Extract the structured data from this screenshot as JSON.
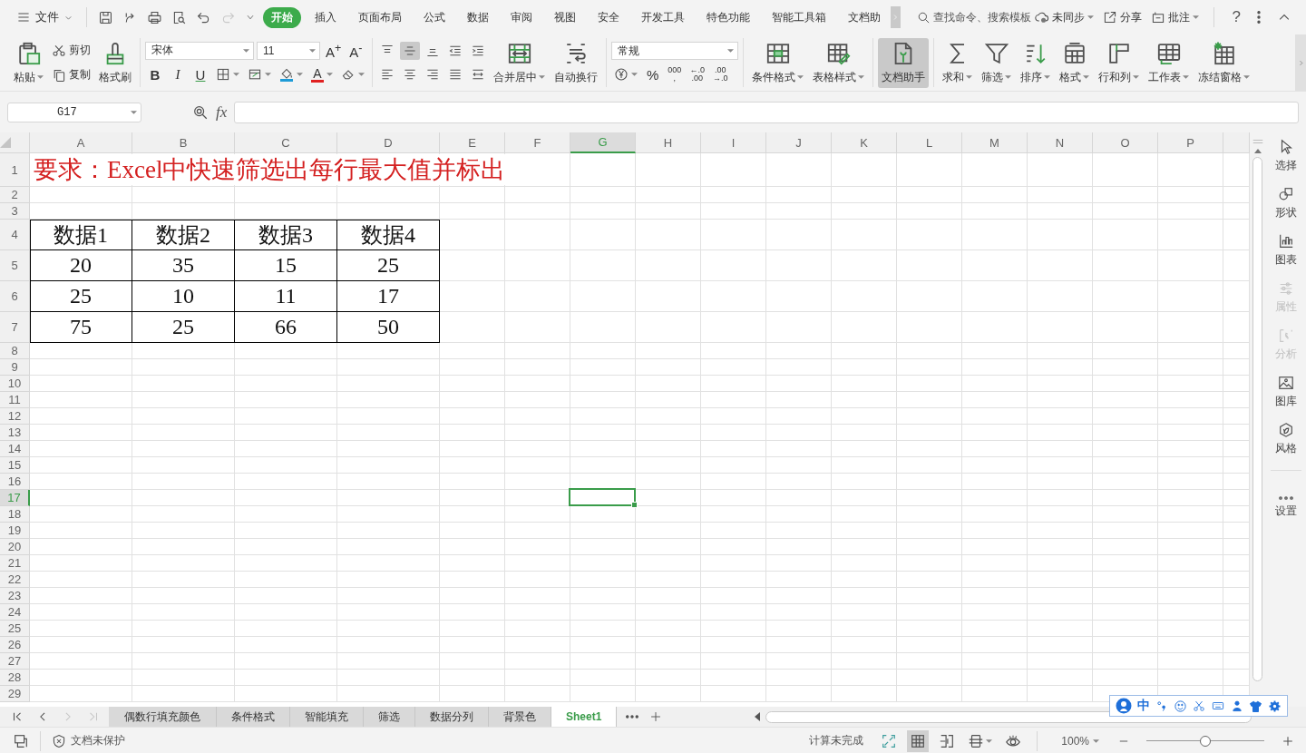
{
  "topbar": {
    "file_menu": "文件",
    "quick_access": [
      {
        "disabled": false
      },
      {
        "disabled": false
      },
      {
        "disabled": false
      },
      {
        "disabled": false
      },
      {
        "disabled": false
      },
      {
        "disabled": true
      }
    ],
    "tabs": [
      {
        "label": "开始",
        "selected": true
      },
      {
        "label": "插入",
        "selected": false
      },
      {
        "label": "页面布局",
        "selected": false
      },
      {
        "label": "公式",
        "selected": false
      },
      {
        "label": "数据",
        "selected": false
      },
      {
        "label": "审阅",
        "selected": false
      },
      {
        "label": "视图",
        "selected": false
      },
      {
        "label": "安全",
        "selected": false
      },
      {
        "label": "开发工具",
        "selected": false
      },
      {
        "label": "特色功能",
        "selected": false
      },
      {
        "label": "智能工具箱",
        "selected": false
      },
      {
        "label": "文档助",
        "selected": false
      }
    ],
    "search": {
      "placeholder": "查找命令、搜索模板"
    },
    "actions": [
      {
        "label": "未同步",
        "dropdown": true
      },
      {
        "label": "分享",
        "dropdown": false
      },
      {
        "label": "批注",
        "dropdown": true
      }
    ],
    "help": "?"
  },
  "ribbon": {
    "paste": "粘贴",
    "cut": "剪切",
    "copy": "复制",
    "format_painter": "格式刷",
    "font_name": "宋体",
    "font_size": "11",
    "font_size_buttons": [
      "A$^{+}$",
      "A$^{-}$"
    ],
    "font_style_buttons": [
      "B",
      "I",
      "U"
    ],
    "font_color": "A",
    "vertical_align": [
      {
        "selected": false
      },
      {
        "selected": true
      },
      {
        "selected": false
      }
    ],
    "horizontal_align": [
      {
        "selected": false
      },
      {
        "selected": false
      },
      {
        "selected": false
      },
      {
        "selected": false
      }
    ],
    "merge_center": "合并居中",
    "wrap_text": "自动换行",
    "number_format": "常规",
    "percent": "%",
    "thousands": [
      "000",
      ","
    ],
    "decimal_increase": [
      "←.0",
      ".00"
    ],
    "decimal_decrease": [
      ".00",
      "→.0"
    ],
    "tool_groups": [
      [
        {
          "label": "条件格式",
          "dropdown": true,
          "selected": false
        },
        {
          "label": "表格样式",
          "dropdown": true,
          "selected": false
        }
      ],
      [
        {
          "label": "文档助手",
          "dropdown": false,
          "selected": true
        }
      ],
      [
        {
          "label": "求和",
          "dropdown": true,
          "selected": false
        },
        {
          "label": "筛选",
          "dropdown": true,
          "selected": false
        },
        {
          "label": "排序",
          "dropdown": true,
          "selected": false
        },
        {
          "label": "格式",
          "dropdown": true,
          "selected": false
        },
        {
          "label": "行和列",
          "dropdown": true,
          "selected": false
        },
        {
          "label": "工作表",
          "dropdown": true,
          "selected": false
        },
        {
          "label": "冻结窗格",
          "dropdown": true,
          "selected": false
        }
      ]
    ]
  },
  "formula_bar": {
    "name_box": "G17",
    "fx": "fx"
  },
  "sheet": {
    "columns": [
      {
        "label": "A",
        "selected": false
      },
      {
        "label": "B",
        "selected": false
      },
      {
        "label": "C",
        "selected": false
      },
      {
        "label": "D",
        "selected": false
      },
      {
        "label": "E",
        "selected": false
      },
      {
        "label": "F",
        "selected": false
      },
      {
        "label": "G",
        "selected": true
      },
      {
        "label": "H",
        "selected": false
      },
      {
        "label": "I",
        "selected": false
      },
      {
        "label": "J",
        "selected": false
      },
      {
        "label": "K",
        "selected": false
      },
      {
        "label": "L",
        "selected": false
      },
      {
        "label": "M",
        "selected": false
      },
      {
        "label": "N",
        "selected": false
      },
      {
        "label": "O",
        "selected": false
      },
      {
        "label": "P",
        "selected": false
      }
    ],
    "rows": [
      {
        "label": "1",
        "selected": false,
        "kind": "title",
        "cells": [
          "要求：Excel中快速筛选出每行最大值并标出"
        ]
      },
      {
        "label": "2",
        "selected": false,
        "kind": "empty"
      },
      {
        "label": "3",
        "selected": false,
        "kind": "empty"
      },
      {
        "label": "4",
        "selected": false,
        "kind": "table",
        "cells": [
          "数据1",
          "数据2",
          "数据3",
          "数据4"
        ]
      },
      {
        "label": "5",
        "selected": false,
        "kind": "table",
        "cells": [
          "20",
          "35",
          "15",
          "25"
        ]
      },
      {
        "label": "6",
        "selected": false,
        "kind": "table",
        "cells": [
          "25",
          "10",
          "11",
          "17"
        ]
      },
      {
        "label": "7",
        "selected": false,
        "kind": "table",
        "cells": [
          "75",
          "25",
          "66",
          "50"
        ]
      },
      {
        "label": "8",
        "selected": false,
        "kind": "empty"
      },
      {
        "label": "9",
        "selected": false,
        "kind": "empty"
      },
      {
        "label": "10",
        "selected": false,
        "kind": "empty"
      },
      {
        "label": "11",
        "selected": false,
        "kind": "empty"
      },
      {
        "label": "12",
        "selected": false,
        "kind": "empty"
      },
      {
        "label": "13",
        "selected": false,
        "kind": "empty"
      },
      {
        "label": "14",
        "selected": false,
        "kind": "empty"
      },
      {
        "label": "15",
        "selected": false,
        "kind": "empty"
      },
      {
        "label": "16",
        "selected": false,
        "kind": "empty"
      },
      {
        "label": "17",
        "selected": true,
        "kind": "empty"
      },
      {
        "label": "18",
        "selected": false,
        "kind": "empty"
      },
      {
        "label": "19",
        "selected": false,
        "kind": "empty"
      },
      {
        "label": "20",
        "selected": false,
        "kind": "empty"
      },
      {
        "label": "21",
        "selected": false,
        "kind": "empty"
      },
      {
        "label": "22",
        "selected": false,
        "kind": "empty"
      },
      {
        "label": "23",
        "selected": false,
        "kind": "empty"
      },
      {
        "label": "24",
        "selected": false,
        "kind": "empty"
      },
      {
        "label": "25",
        "selected": false,
        "kind": "empty"
      },
      {
        "label": "26",
        "selected": false,
        "kind": "empty"
      },
      {
        "label": "27",
        "selected": false,
        "kind": "empty"
      },
      {
        "label": "28",
        "selected": false,
        "kind": "empty"
      },
      {
        "label": "29",
        "selected": false,
        "kind": "empty"
      }
    ]
  },
  "sidebar": {
    "items": [
      {
        "label": "选择",
        "disabled": false
      },
      {
        "label": "形状",
        "disabled": false
      },
      {
        "label": "图表",
        "disabled": false
      },
      {
        "label": "属性",
        "disabled": true
      },
      {
        "label": "分析",
        "disabled": true
      },
      {
        "label": "图库",
        "disabled": false
      },
      {
        "label": "风格",
        "disabled": false
      }
    ],
    "settings": "设置"
  },
  "sheet_tabs": [
    {
      "label": "偶数行填充颜色",
      "selected": false
    },
    {
      "label": "条件格式",
      "selected": false
    },
    {
      "label": "智能填充",
      "selected": false
    },
    {
      "label": "筛选",
      "selected": false
    },
    {
      "label": "数据分列",
      "selected": false
    },
    {
      "label": "背景色",
      "selected": false
    },
    {
      "label": "Sheet1",
      "selected": true
    }
  ],
  "ime_toolbar": {
    "mode": "中"
  },
  "status_bar": {
    "protection": "文档未保护",
    "calc_status": "计算未完成",
    "view_modes": [
      {
        "selected": false
      },
      {
        "selected": true
      },
      {
        "selected": false
      },
      {
        "selected": false
      },
      {
        "selected": false
      }
    ],
    "zoom": "100%",
    "zoom_slider": {
      "level": 0.5
    }
  }
}
